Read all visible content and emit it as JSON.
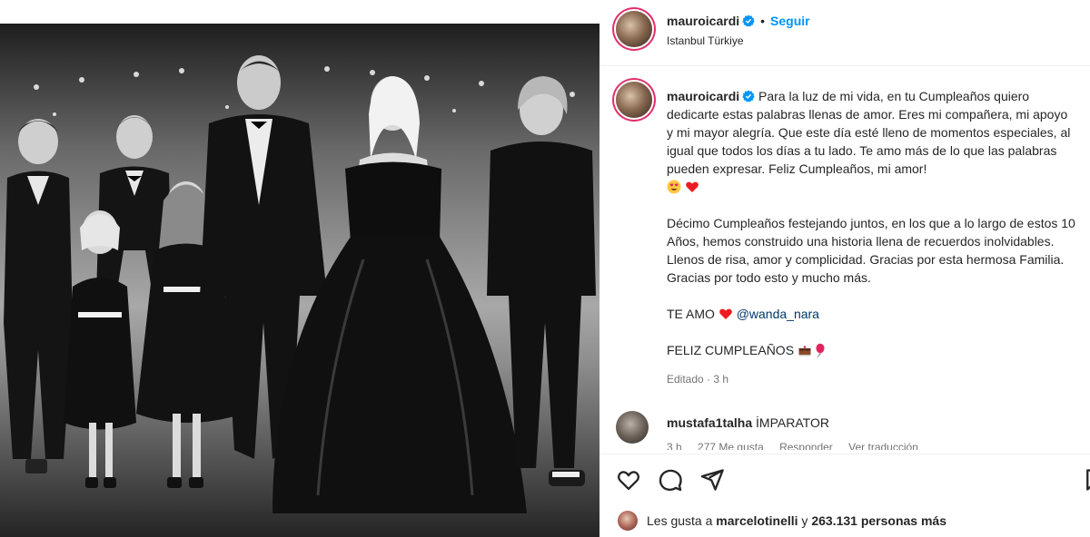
{
  "post": {
    "username": "mauroicardi",
    "follow_label": "Seguir",
    "separator": "•",
    "location": "Istanbul Türkiye"
  },
  "caption": {
    "username": "mauroicardi",
    "paragraph1": "Para la luz de mi vida, en tu Cumpleaños quiero dedicarte estas palabras llenas de amor. Eres mi compañera, mi apoyo y mi mayor alegría. Que este día esté lleno de momentos especiales, al igual que todos los días a tu lado. Te amo más de lo que las palabras pueden expresar. Feliz Cumpleaños, mi amor!",
    "paragraph2": "Décimo Cumpleaños festejando juntos, en los que a lo largo de estos 10 Años, hemos construido una historia llena de recuerdos inolvidables. Llenos de risa, amor y complicidad. Gracias por esta hermosa Familia. Gracias por todo esto y mucho más.",
    "te_amo": "TE AMO",
    "mention": "@wanda_nara",
    "feliz": "FELIZ CUMPLEAÑOS",
    "edited": "Editado · 3 h"
  },
  "comment": {
    "username": "mustafa1talha",
    "text": "İMPARATOR",
    "time": "3 h",
    "likes": "277 Me gusta",
    "reply": "Responder",
    "translation": "Ver traducción"
  },
  "likes": {
    "prefix": "Les gusta a ",
    "user": "marcelotinelli",
    "middle": " y ",
    "count": "263.131 personas más"
  },
  "colors": {
    "accent": "#0095f6",
    "verified": "#0095f6",
    "heart": "#ed1c24",
    "mention": "#00376b",
    "muted": "#737373"
  },
  "icons": [
    "verified-icon",
    "heart-icon",
    "comment-icon",
    "share-icon",
    "save-icon",
    "heart-eyes-emoji",
    "red-heart-emoji",
    "cake-emoji",
    "balloon-emoji"
  ]
}
